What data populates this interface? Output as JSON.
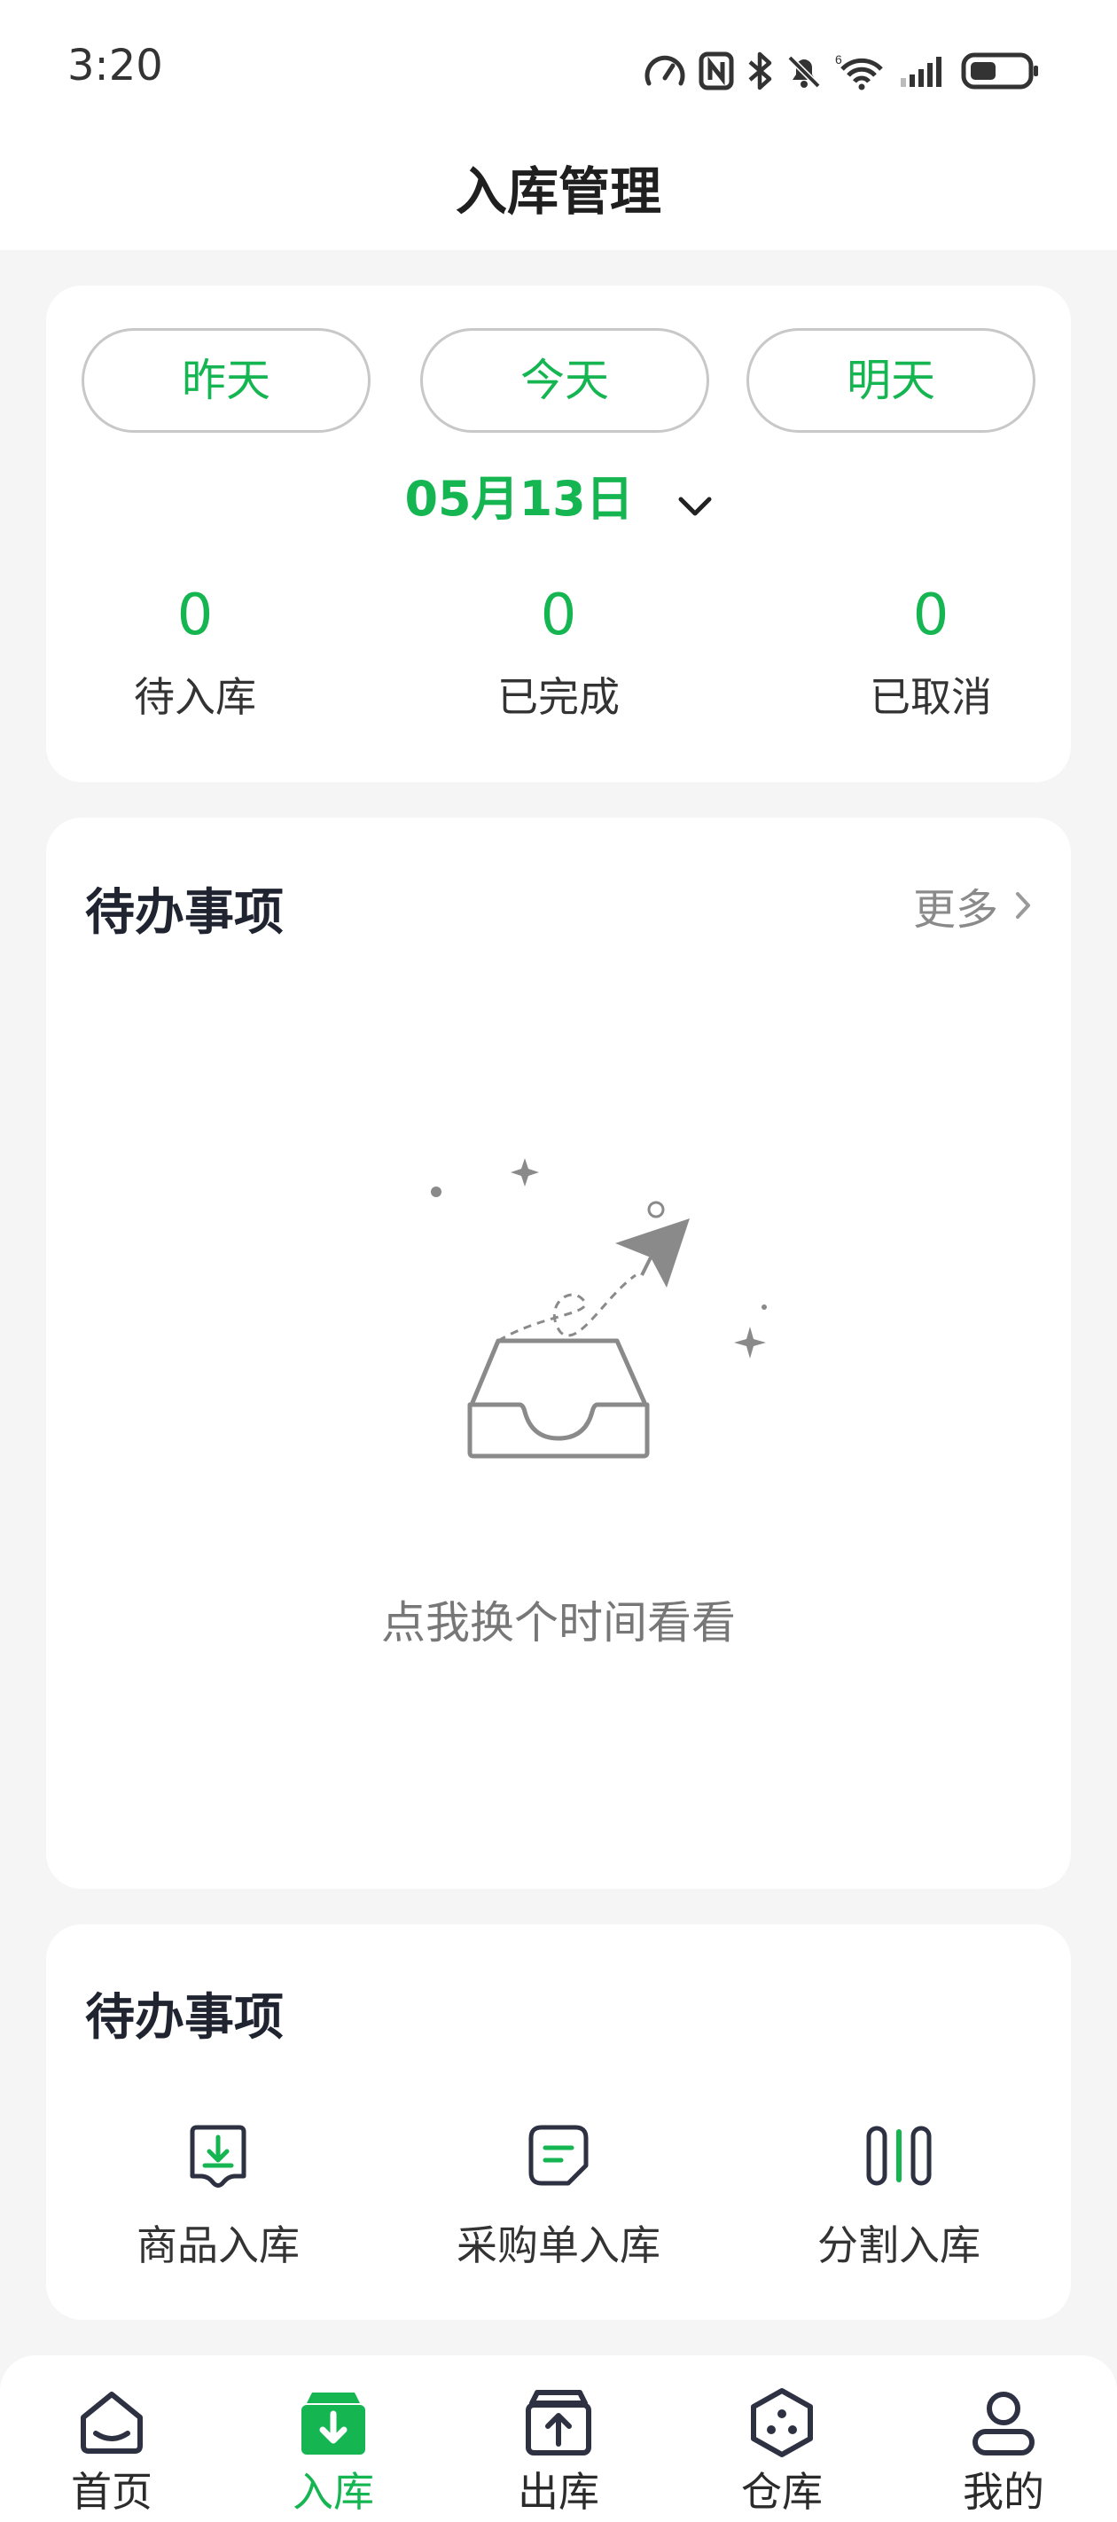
{
  "status_bar": {
    "time": "3:20"
  },
  "header": {
    "title": "入库管理"
  },
  "date_selector": {
    "buttons": [
      {
        "label": "昨天"
      },
      {
        "label": "今天"
      },
      {
        "label": "明天"
      }
    ],
    "current_date": "05月13日",
    "stats": [
      {
        "value": "0",
        "label": "待入库"
      },
      {
        "value": "0",
        "label": "已完成"
      },
      {
        "value": "0",
        "label": "已取消"
      }
    ]
  },
  "todo": {
    "title": "待办事项",
    "more_label": "更多",
    "empty_text": "点我换个时间看看"
  },
  "actions": {
    "title": "待办事项",
    "items": [
      {
        "label": "商品入库",
        "icon": "download-tray-icon"
      },
      {
        "label": "采购单入库",
        "icon": "order-list-icon"
      },
      {
        "label": "分割入库",
        "icon": "split-icon"
      }
    ]
  },
  "tab_bar": {
    "items": [
      {
        "label": "首页",
        "icon": "home-icon"
      },
      {
        "label": "入库",
        "icon": "inbound-icon"
      },
      {
        "label": "出库",
        "icon": "outbound-icon"
      },
      {
        "label": "仓库",
        "icon": "warehouse-icon"
      },
      {
        "label": "我的",
        "icon": "profile-icon"
      }
    ],
    "active_index": 1
  },
  "colors": {
    "accent": "#15b552",
    "background": "#f5f5f5",
    "card": "#ffffff"
  }
}
